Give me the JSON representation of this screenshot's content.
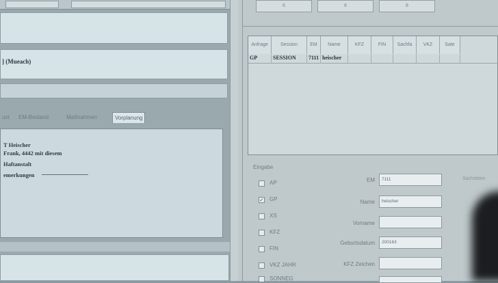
{
  "left_window": {
    "patient_name": "] (Mueach)",
    "tabs": [
      {
        "label": "ust"
      },
      {
        "label": "EM-Bestand"
      },
      {
        "label": "Maßnahmen"
      },
      {
        "label": "Vorplanung",
        "active": true
      }
    ],
    "detail_lines": [
      "T     Heischer",
      "Frank, 4442 mit diesem",
      "Haftanstalt",
      "emerkungen"
    ]
  },
  "right_window": {
    "top_buttons": [
      {
        "label": "6"
      },
      {
        "label": "8"
      },
      {
        "label": "8"
      }
    ],
    "table": {
      "columns": [
        "Anfrage",
        "Session",
        "EM",
        "Name",
        "KFZ",
        "FIN",
        "Sachfa",
        "VKZ",
        "Sate"
      ],
      "rows": [
        [
          "GP",
          "SESSION",
          "7111",
          "heischer",
          "",
          "",
          "",
          "",
          ""
        ]
      ]
    },
    "eingabe": {
      "title": "Eingabe",
      "checkboxes": [
        {
          "label": "AP",
          "checked": false
        },
        {
          "label": "GP",
          "checked": true
        },
        {
          "label": "XS",
          "checked": false
        },
        {
          "label": "KFZ",
          "checked": false
        },
        {
          "label": "FIN",
          "checked": false
        },
        {
          "label": "VKZ JAHR",
          "checked": false
        },
        {
          "label": "SONNEG",
          "checked": false
        }
      ],
      "fields": [
        {
          "label": "EM",
          "value": "7111"
        },
        {
          "label": "Name",
          "value": "heischer"
        },
        {
          "label": "Vorname",
          "value": ""
        },
        {
          "label": "Geburtsdatum",
          "value": "200163"
        },
        {
          "label": "KFZ Zeichen",
          "value": ""
        }
      ],
      "right_label": "Sachdaten"
    }
  }
}
